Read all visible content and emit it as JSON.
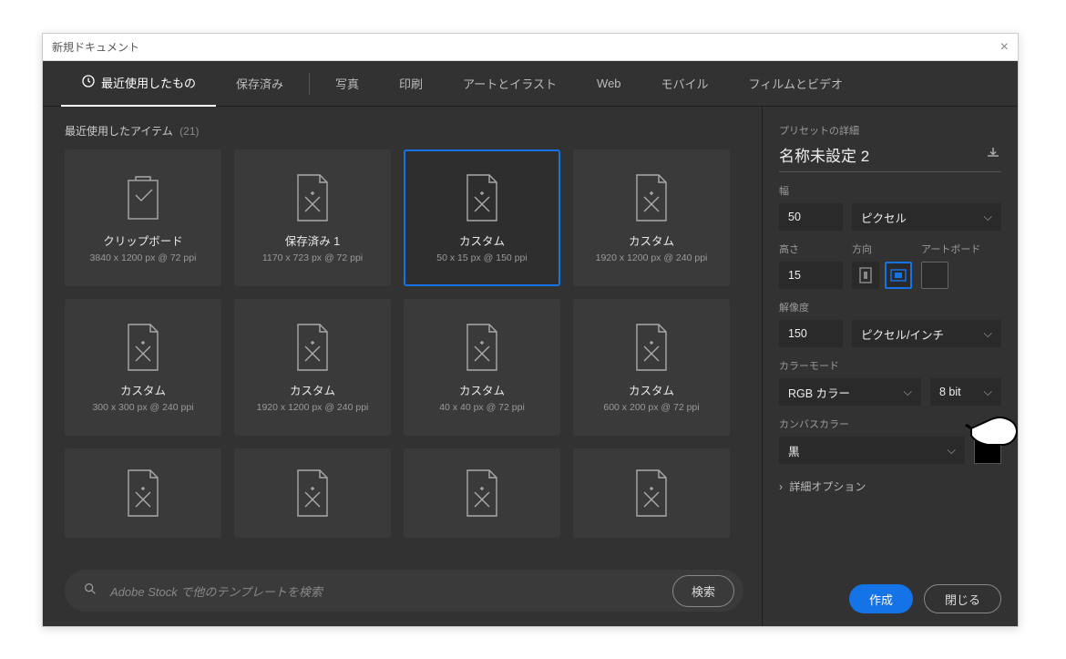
{
  "window": {
    "title": "新規ドキュメント"
  },
  "tabs": {
    "recent": "最近使用したもの",
    "saved": "保存済み",
    "photo": "写真",
    "print": "印刷",
    "art": "アートとイラスト",
    "web": "Web",
    "mobile": "モバイル",
    "film": "フィルムとビデオ"
  },
  "section": {
    "title": "最近使用したアイテム",
    "count": "(21)"
  },
  "presets": [
    {
      "title": "クリップボード",
      "meta": "3840 x 1200 px @ 72 ppi",
      "icon": "clipboard"
    },
    {
      "title": "保存済み 1",
      "meta": "1170 x 723 px @ 72 ppi",
      "icon": "doc"
    },
    {
      "title": "カスタム",
      "meta": "50 x 15 px @ 150 ppi",
      "icon": "doc",
      "selected": true
    },
    {
      "title": "カスタム",
      "meta": "1920 x 1200 px @ 240 ppi",
      "icon": "doc"
    },
    {
      "title": "カスタム",
      "meta": "300 x 300 px @ 240 ppi",
      "icon": "doc"
    },
    {
      "title": "カスタム",
      "meta": "1920 x 1200 px @ 240 ppi",
      "icon": "doc"
    },
    {
      "title": "カスタム",
      "meta": "40 x 40 px @ 72 ppi",
      "icon": "doc"
    },
    {
      "title": "カスタム",
      "meta": "600 x 200 px @ 72 ppi",
      "icon": "doc"
    }
  ],
  "search": {
    "placeholder": "Adobe Stock で他のテンプレートを検索",
    "button": "検索"
  },
  "details": {
    "heading": "プリセットの詳細",
    "name": "名称未設定 2",
    "width_label": "幅",
    "width_value": "50",
    "units": "ピクセル",
    "height_label": "高さ",
    "height_value": "15",
    "orient_label": "方向",
    "artboard_label": "アートボード",
    "res_label": "解像度",
    "res_value": "150",
    "res_units": "ピクセル/インチ",
    "mode_label": "カラーモード",
    "mode_value": "RGB カラー",
    "depth": "8 bit",
    "bg_label": "カンバスカラー",
    "bg_value": "黒",
    "advanced": "詳細オプション",
    "create": "作成",
    "close": "閉じる"
  }
}
